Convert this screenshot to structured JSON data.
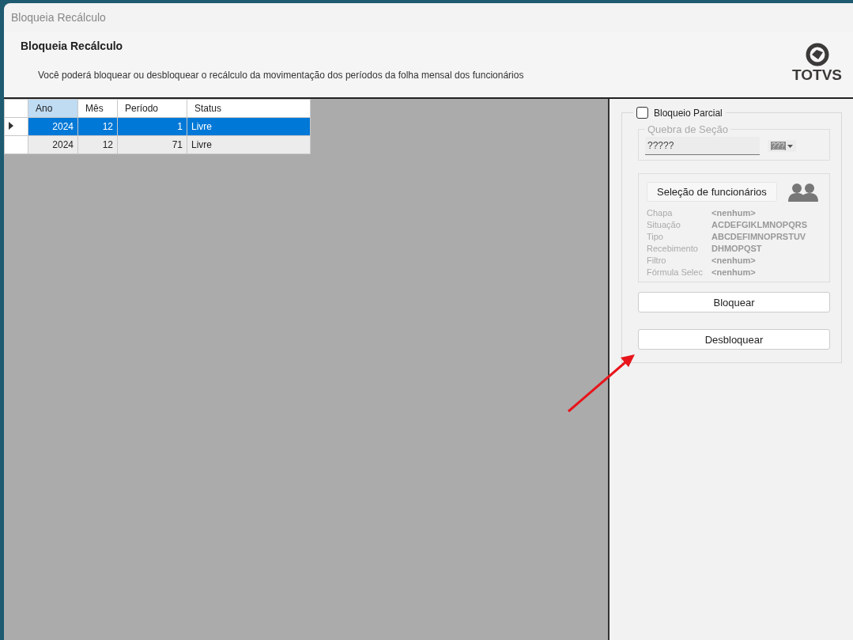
{
  "window": {
    "title": "Bloqueia Recálculo"
  },
  "header": {
    "title": "Bloqueia Recálculo",
    "description": "Você poderá bloquear ou desbloquear o recálculo da movimentação dos períodos da folha mensal dos funcionários",
    "logo_text": "TOTVS"
  },
  "table": {
    "columns": [
      {
        "label": "Ano",
        "selected": true
      },
      {
        "label": "Mês",
        "selected": false
      },
      {
        "label": "Período",
        "selected": false
      },
      {
        "label": "Status",
        "selected": false
      }
    ],
    "rows": [
      {
        "cells": [
          "2024",
          "12",
          "1",
          "Livre"
        ],
        "selected": true
      },
      {
        "cells": [
          "2024",
          "12",
          "71",
          "Livre"
        ],
        "selected": false
      }
    ]
  },
  "partial_block": {
    "label": "Bloqueio Parcial",
    "checked": false,
    "section_break": {
      "label": "Quebra de Seção",
      "value": "?????",
      "format_button": "???",
      "disabled": true
    },
    "employee_selection": {
      "button": "Seleção de funcionários",
      "disabled": true,
      "fields": [
        {
          "label": "Chapa",
          "value": "<nenhum>"
        },
        {
          "label": "Situação",
          "value": "ACDEFGIKLMNOPQRS"
        },
        {
          "label": "Tipo",
          "value": "ABCDEFIMNOPRSTUV"
        },
        {
          "label": "Recebimento",
          "value": "DHMOPQST"
        },
        {
          "label": "Filtro",
          "value": "<nenhum>"
        },
        {
          "label": "Fórmula Selec",
          "value": "<nenhum>"
        }
      ]
    },
    "buttons": [
      "Bloquear",
      "Desbloquear"
    ]
  }
}
